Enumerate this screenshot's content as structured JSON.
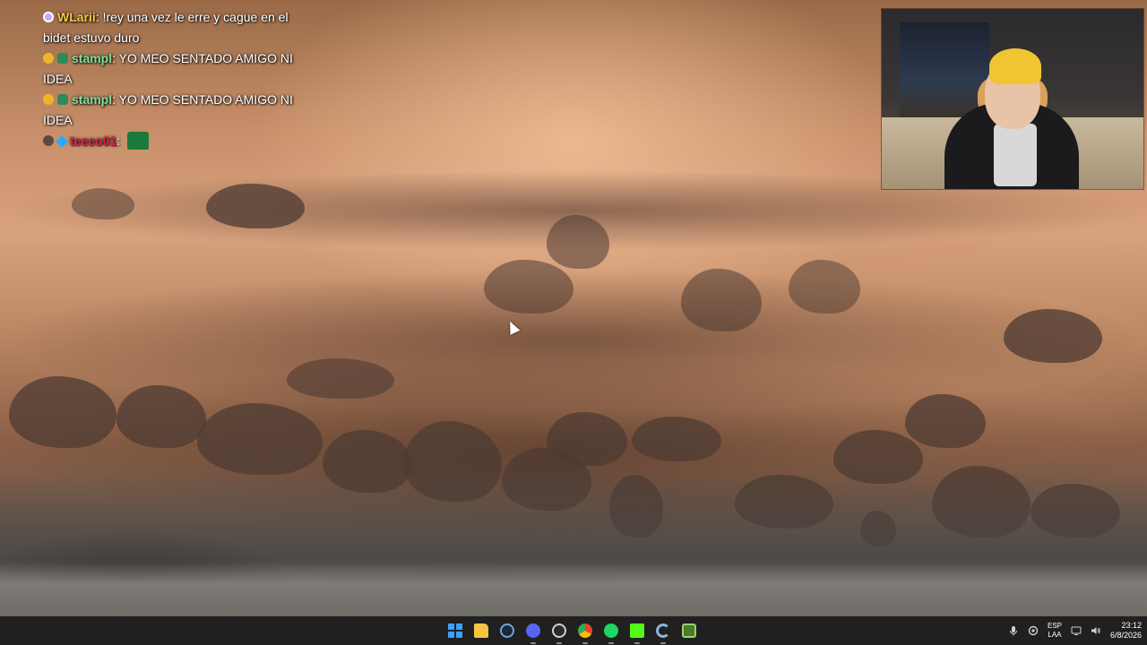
{
  "chat": {
    "messages": [
      {
        "user": "WLarii",
        "user_color": "#f2c94c",
        "text": "!rey una vez le erre y cague en el bidet estuvo duro",
        "badges": [
          "sub-badge-icon"
        ]
      },
      {
        "user": "stampl",
        "user_color": "#7fe0a0",
        "text": "YO MEO SENTADO AMIGO NI IDEA",
        "badges": [
          "smiley-badge-icon",
          "bot-badge-icon"
        ]
      },
      {
        "user": "stampl",
        "user_color": "#7fe0a0",
        "text": "YO MEO SENTADO AMIGO NI IDEA",
        "badges": [
          "smiley-badge-icon",
          "bot-badge-icon"
        ]
      },
      {
        "user": "teeeo01",
        "user_color": "#e0204a",
        "text": "",
        "badges": [
          "skull-badge-icon",
          "gem-badge-icon"
        ],
        "emote": "green-emote-icon"
      }
    ]
  },
  "taskbar": {
    "apps": [
      {
        "name": "start",
        "icon": "windows-start-icon",
        "color": "#3aa0ff"
      },
      {
        "name": "file-explorer",
        "icon": "folder-icon",
        "color": "#f5c542"
      },
      {
        "name": "steam",
        "icon": "steam-icon",
        "color": "#6aa7d8"
      },
      {
        "name": "discord",
        "icon": "discord-icon",
        "color": "#5865f2"
      },
      {
        "name": "obs",
        "icon": "obs-icon",
        "color": "#444444"
      },
      {
        "name": "chrome",
        "icon": "chrome-icon",
        "color": "#e94235"
      },
      {
        "name": "spotify",
        "icon": "spotify-icon",
        "color": "#1ed760"
      },
      {
        "name": "kick",
        "icon": "kick-icon",
        "color": "#53fc18"
      },
      {
        "name": "ccleaner",
        "icon": "c-app-icon",
        "color": "#8ab4d8"
      },
      {
        "name": "game-app",
        "icon": "game-app-icon",
        "color": "#9bd36a"
      }
    ],
    "tray": {
      "lang_top": "ESP",
      "lang_bottom": "LAA",
      "time": "23:12",
      "date": "6/8/2026"
    }
  }
}
